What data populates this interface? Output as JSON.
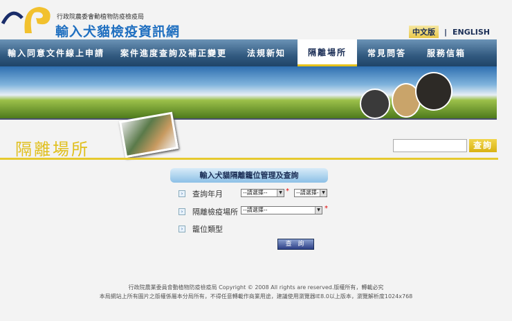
{
  "header": {
    "agency": "行政院農委會動植物防疫檢疫局",
    "site_title": "輸入犬貓檢疫資訊網",
    "lang_zh": "中文版",
    "lang_sep": "|",
    "lang_en": "ENGLISH"
  },
  "nav": [
    {
      "label": "輸入同意文件線上申請"
    },
    {
      "label": "案件進度查詢及補正變更"
    },
    {
      "label": "法規新知"
    },
    {
      "label": "隔離場所",
      "active": true
    },
    {
      "label": "常見問答"
    },
    {
      "label": "服務信箱"
    }
  ],
  "page": {
    "title": "隔離場所",
    "search_button": "查詢",
    "search_value": ""
  },
  "form": {
    "title": "輸入犬貓隔離籠位管理及查詢",
    "year_month_label": "查詢年月",
    "year_select": "--請選擇--",
    "month_select": "--請選擇-",
    "facility_label": "隔離檢疫場所",
    "facility_select": "--請選擇--",
    "cage_type_label": "籠位類型",
    "submit": "查 詢",
    "required": "*",
    "bullet": "›",
    "dropdown": "▼"
  },
  "footer": {
    "line1": "行政院農業委員會動植物防疫檢疫局 Copyright © 2008 All rights are reserved.版權所有，轉載必究",
    "line2": "本局網站上所有圖片之版權係屬本分局所有，不得任意轉載作商業用途，建議使用瀏覽器IE8.0以上版本，瀏覽解析度1024x768"
  },
  "colors": {
    "accent": "#e0bf1d",
    "nav": "#325a80",
    "link": "#1f6fc0"
  }
}
